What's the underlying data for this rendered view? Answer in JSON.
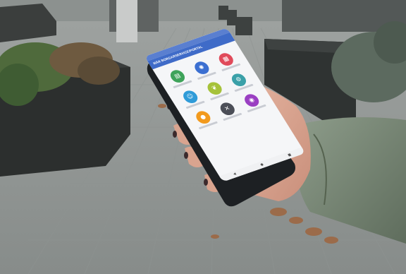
{
  "image": {
    "alt_subject": "hand holding smartphone with app launcher over a paved courtyard"
  },
  "phone": {
    "app_bar_title": "MÅR BORGARSERVICE/PORTAL",
    "tiles": [
      {
        "icon": "document-icon",
        "color": "#3ea35a"
      },
      {
        "icon": "gear-icon",
        "color": "#3b6fd1"
      },
      {
        "icon": "calendar-icon",
        "color": "#e04a5a"
      },
      {
        "icon": "people-icon",
        "color": "#2f9bd8"
      },
      {
        "icon": "leaf-icon",
        "color": "#a6c23a"
      },
      {
        "icon": "settings-icon",
        "color": "#3aa0a8"
      },
      {
        "icon": "location-icon",
        "color": "#f29a1e"
      },
      {
        "icon": "tools-icon",
        "color": "#4b4e57"
      },
      {
        "icon": "chat-icon",
        "color": "#9a3fc2"
      }
    ],
    "nav": [
      "◀",
      "●",
      "■"
    ]
  },
  "colors": {
    "pavement": "#a7aba9",
    "planter": "#2c2f2e",
    "jacket": "#7c8a79",
    "phone_body": "#1d2023"
  }
}
